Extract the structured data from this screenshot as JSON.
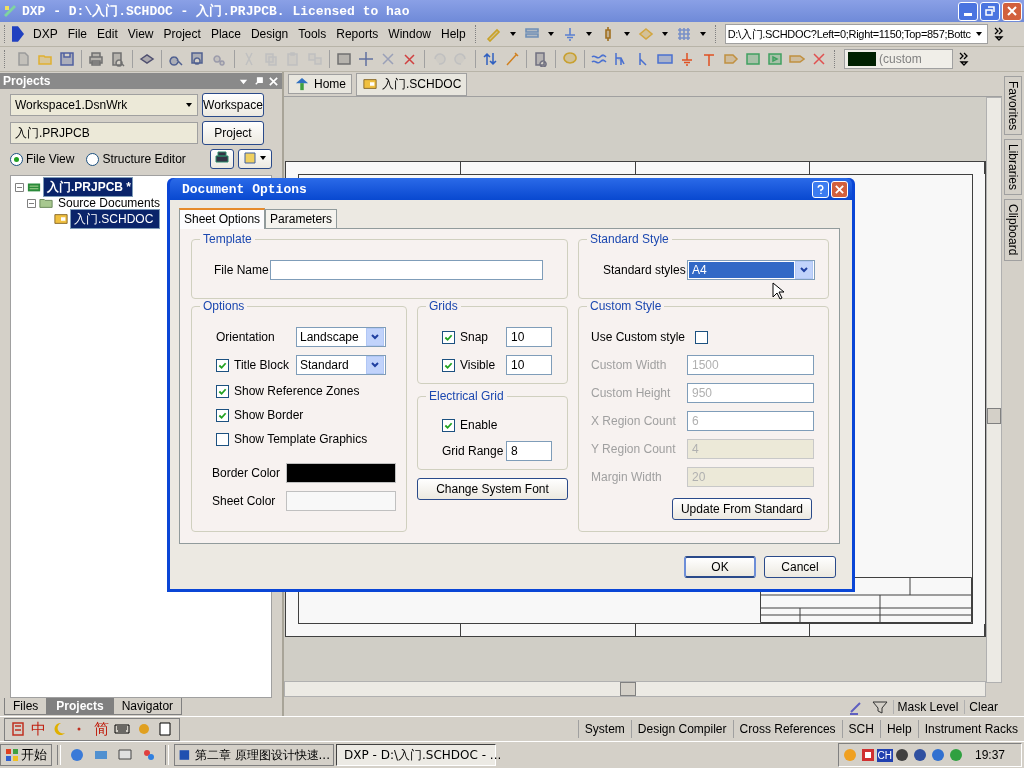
{
  "window": {
    "title": "DXP - D:\\入门.SCHDOC - 入门.PRJPCB. Licensed to hao"
  },
  "menu": [
    "DXP",
    "File",
    "Edit",
    "View",
    "Project",
    "Place",
    "Design",
    "Tools",
    "Reports",
    "Window",
    "Help"
  ],
  "address": "D:\\入门.SCHDOC?Left=0;Right=1150;Top=857;Bottc",
  "color_picker": {
    "label": "(custom"
  },
  "projects_panel": {
    "title": "Projects",
    "workspace": "Workspace1.DsnWrk",
    "workspace_button": "Workspace",
    "project": "入门.PRJPCB",
    "project_button": "Project",
    "views": [
      {
        "label": "File View",
        "selected": true
      },
      {
        "label": "Structure Editor",
        "selected": false
      }
    ],
    "tree": [
      {
        "label": "入门.PRJPCB *",
        "kind": "project",
        "expanded": true,
        "selected": true,
        "children": [
          {
            "label": "Source Documents",
            "kind": "folder",
            "expanded": true,
            "selected": false,
            "children": [
              {
                "label": "入门.SCHDOC",
                "kind": "schematic",
                "selected": true
              }
            ]
          }
        ]
      }
    ]
  },
  "doc_tabs": [
    {
      "label": "Home",
      "kind": "home"
    },
    {
      "label": "入门.SCHDOC",
      "kind": "schematic"
    }
  ],
  "side_tabs": [
    "Favorites",
    "Libraries",
    "Clipboard"
  ],
  "panel_tabs": [
    {
      "label": "Files",
      "selected": false
    },
    {
      "label": "Projects",
      "selected": true
    },
    {
      "label": "Navigator",
      "selected": false
    }
  ],
  "mask": {
    "label": "Mask Level",
    "clear": "Clear"
  },
  "ime": [
    "中",
    "简"
  ],
  "status_buttons": [
    "System",
    "Design Compiler",
    "Cross References",
    "SCH",
    "Help",
    "Instrument Racks"
  ],
  "taskbar": {
    "start": "开始",
    "tasks": [
      {
        "label": "第二章 原理图设计快速...",
        "selected": false
      },
      {
        "label": "DXP - D:\\入门.SCHDOC - ...",
        "selected": true
      }
    ],
    "tray": "CH",
    "clock": "19:37"
  },
  "dialog": {
    "title": "Document Options",
    "tabs": [
      {
        "label": "Sheet Options",
        "selected": true
      },
      {
        "label": "Parameters",
        "selected": false
      }
    ],
    "template": {
      "legend": "Template",
      "file_name_label": "File Name"
    },
    "options": {
      "legend": "Options",
      "orientation_label": "Orientation",
      "orientation": "Landscape",
      "title_block": {
        "label": "Title Block",
        "checked": true,
        "value": "Standard"
      },
      "checks": [
        {
          "label": "Show Reference Zones",
          "checked": true
        },
        {
          "label": "Show Border",
          "checked": true
        },
        {
          "label": "Show Template Graphics",
          "checked": false
        }
      ],
      "border_color_label": "Border Color",
      "sheet_color_label": "Sheet Color"
    },
    "grids": {
      "legend": "Grids",
      "items": [
        {
          "label": "Snap",
          "checked": true,
          "value": "10"
        },
        {
          "label": "Visible",
          "checked": true,
          "value": "10"
        }
      ]
    },
    "electrical_grid": {
      "legend": "Electrical Grid",
      "enable": {
        "label": "Enable",
        "checked": true
      },
      "range_label": "Grid Range",
      "range": "8"
    },
    "change_font_button": "Change System Font",
    "standard_style": {
      "legend": "Standard Style",
      "label": "Standard styles",
      "value": "A4"
    },
    "custom_style": {
      "legend": "Custom Style",
      "use_custom": {
        "label": "Use Custom style",
        "checked": false
      },
      "fields": [
        {
          "label": "Custom Width",
          "value": "1500",
          "disabled": true,
          "shaded": false
        },
        {
          "label": "Custom Height",
          "value": "950",
          "disabled": true,
          "shaded": false
        },
        {
          "label": "X Region Count",
          "value": "6",
          "disabled": true,
          "shaded": false
        },
        {
          "label": "Y Region Count",
          "value": "4",
          "disabled": true,
          "shaded": true
        },
        {
          "label": "Margin Width",
          "value": "20",
          "disabled": true,
          "shaded": true
        }
      ],
      "update_button": "Update From Standard"
    },
    "buttons": [
      "OK",
      "Cancel"
    ]
  }
}
